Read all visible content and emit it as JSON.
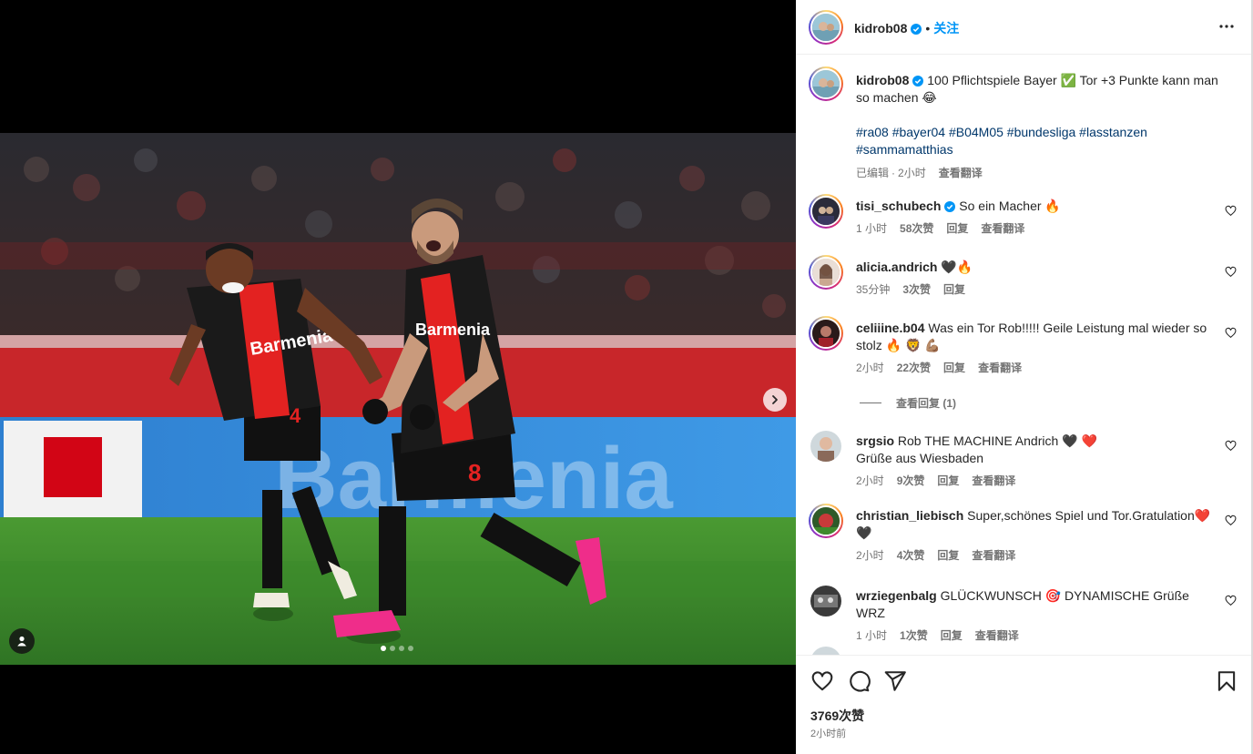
{
  "post": {
    "author": "kidrob08",
    "follow_label": "关注",
    "separator": "•",
    "more_icon": "more-horizontal-icon"
  },
  "caption": {
    "author": "kidrob08",
    "text": "100 Pflichtspiele Bayer ✅ Tor +3 Punkte kann man so machen 😂",
    "hashtags": "#ra08 #bayer04 #B04M05 #bundesliga #lasstanzen #sammamatthias",
    "edited": "已编辑",
    "time": "2小时",
    "translate": "查看翻译"
  },
  "comments": [
    {
      "user": "tisi_schubech",
      "verified": true,
      "text": "So ein Macher 🔥",
      "time": "1 小时",
      "likes": "58次赞",
      "reply": "回复",
      "translate": "查看翻译"
    },
    {
      "user": "alicia.andrich",
      "verified": false,
      "text": "🖤🔥",
      "time": "35分钟",
      "likes": "3次赞",
      "reply": "回复",
      "translate": ""
    },
    {
      "user": "celiiine.b04",
      "verified": false,
      "text": "Was ein Tor Rob!!!!! Geile Leistung mal wieder so stolz 🔥 🦁 💪🏽",
      "time": "2小时",
      "likes": "22次赞",
      "reply": "回复",
      "translate": "查看翻译",
      "replies": "查看回复 (1)"
    },
    {
      "user": "srgsio",
      "verified": false,
      "text": "Rob THE MACHINE Andrich 🖤 ❤️",
      "text2": "Grüße aus Wiesbaden",
      "time": "2小时",
      "likes": "9次赞",
      "reply": "回复",
      "translate": "查看翻译"
    },
    {
      "user": "christian_liebisch",
      "verified": false,
      "text": "Super,schönes Spiel und Tor.Gratulation❤️ 🖤",
      "time": "2小时",
      "likes": "4次赞",
      "reply": "回复",
      "translate": "查看翻译"
    },
    {
      "user": "wrziegenbalg",
      "verified": false,
      "text": "GLÜCKWUNSCH 🎯 DYNAMISCHE Grüße WRZ",
      "time": "1 小时",
      "likes": "1次赞",
      "reply": "回复",
      "translate": "查看翻译"
    }
  ],
  "footer": {
    "likes": "3769次赞",
    "posted": "2小时前"
  },
  "photo": {
    "jersey_sponsor": "Barmenia",
    "board_text": "Barmenia",
    "number_left": "4",
    "number_right": "8"
  },
  "colors": {
    "link": "#0095f6",
    "hashtag": "#00376b",
    "verified": "#0095f6",
    "jersey_red": "#e32221",
    "pitch_green": "#3f8a2c"
  },
  "carousel": {
    "total": 4,
    "active": 1
  }
}
